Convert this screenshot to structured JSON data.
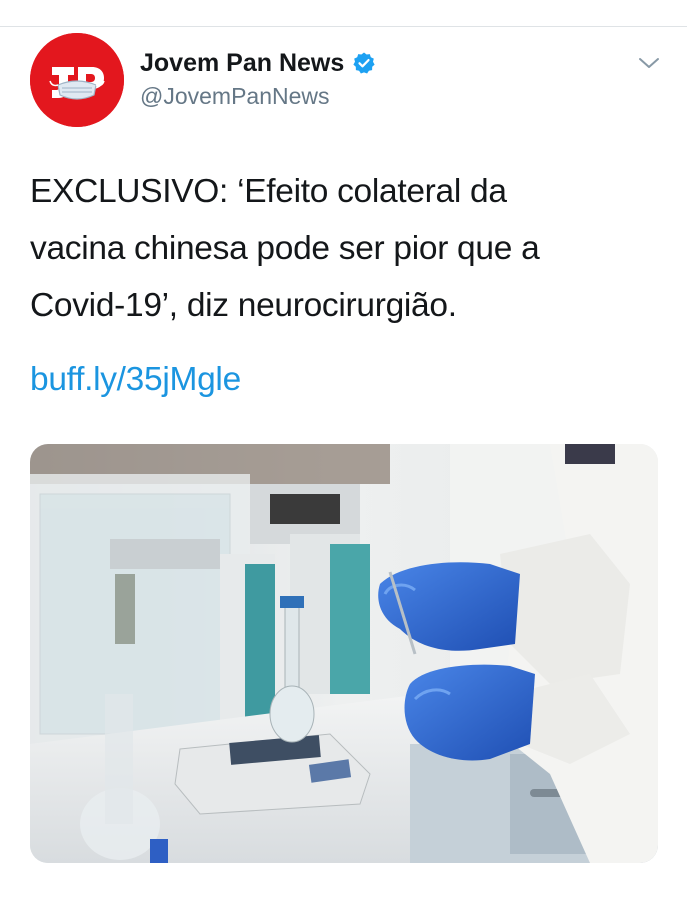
{
  "account": {
    "display_name": "Jovem Pan News",
    "handle": "@JovemPanNews",
    "verified": true,
    "avatar_color": "#e3171e"
  },
  "tweet": {
    "text_lines": [
      "EXCLUSIVO: ‘Efeito colateral da",
      "vacina chinesa pode ser pior que a",
      "Covid-19’, diz neurocirurgião."
    ],
    "link": "buff.ly/35jMgle"
  },
  "colors": {
    "text": "#14171a",
    "secondary_text": "#657786",
    "link": "#1b95e0",
    "verified_badge": "#1da1f2"
  },
  "icons": {
    "verified": "verified-badge-icon",
    "menu": "chevron-down-icon"
  }
}
